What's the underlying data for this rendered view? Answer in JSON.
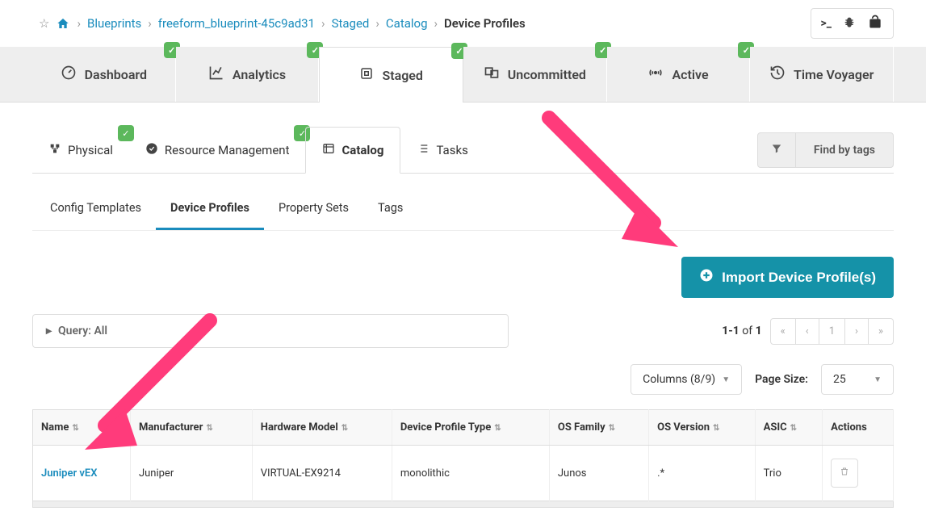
{
  "breadcrumb": {
    "blueprints": "Blueprints",
    "blueprint_name": "freeform_blueprint-45c9ad31",
    "staged": "Staged",
    "catalog": "Catalog",
    "current": "Device Profiles"
  },
  "main_tabs": {
    "dashboard": "Dashboard",
    "analytics": "Analytics",
    "staged": "Staged",
    "uncommitted": "Uncommitted",
    "active": "Active",
    "time_voyager": "Time Voyager"
  },
  "sub_tabs": {
    "physical": "Physical",
    "resource_mgmt": "Resource Management",
    "catalog": "Catalog",
    "tasks": "Tasks"
  },
  "find_by_tags": "Find by tags",
  "tertiary_tabs": {
    "config_templates": "Config Templates",
    "device_profiles": "Device Profiles",
    "property_sets": "Property Sets",
    "tags": "Tags"
  },
  "import_button": "Import Device Profile(s)",
  "query": {
    "label": "Query: All"
  },
  "pager": {
    "range": "1-1",
    "of": "of",
    "total": "1",
    "page": "1"
  },
  "columns_dropdown": "Columns (8/9)",
  "page_size_label": "Page Size:",
  "page_size_value": "25",
  "table": {
    "headers": {
      "name": "Name",
      "manufacturer": "Manufacturer",
      "hw_model": "Hardware Model",
      "dp_type": "Device Profile Type",
      "os_family": "OS Family",
      "os_version": "OS Version",
      "asic": "ASIC",
      "actions": "Actions"
    },
    "row": {
      "name": "Juniper vEX",
      "manufacturer": "Juniper",
      "hw_model": "VIRTUAL-EX9214",
      "dp_type": "monolithic",
      "os_family": "Junos",
      "os_version": ".*",
      "asic": "Trio"
    }
  }
}
